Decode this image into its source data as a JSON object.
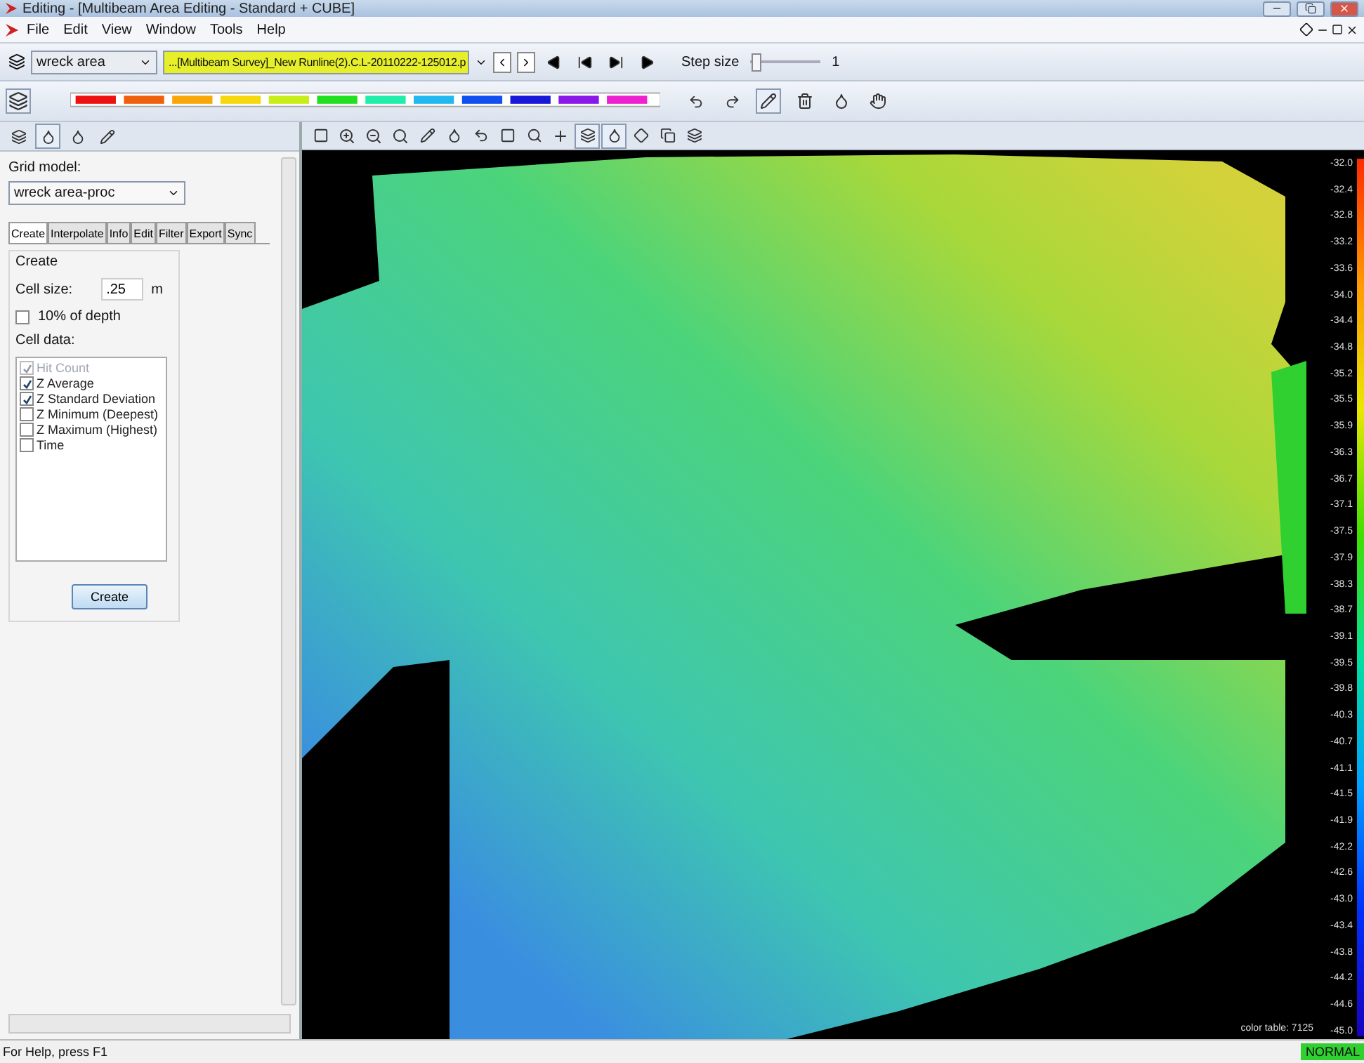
{
  "window": {
    "title": "Editing - [Multibeam Area Editing - Standard + CUBE]"
  },
  "menu": [
    "File",
    "Edit",
    "View",
    "Window",
    "Tools",
    "Help"
  ],
  "toolbar": {
    "area": "wreck area",
    "line": "...[Multibeam Survey]_New Runline(2).C.L-20110222-125012.p",
    "step_label": "Step size",
    "step_slider": {
      "level": 0.02
    },
    "step_value": "1"
  },
  "panel": {
    "grid_model_label": "Grid model:",
    "grid_model": "wreck area-proc",
    "tabs": [
      {
        "label": "Create",
        "selected": true
      },
      {
        "label": "Interpolate",
        "selected": false
      },
      {
        "label": "Info",
        "selected": false
      },
      {
        "label": "Edit",
        "selected": false
      },
      {
        "label": "Filter",
        "selected": false
      },
      {
        "label": "Export",
        "selected": false
      },
      {
        "label": "Sync",
        "selected": false
      }
    ],
    "group_title": "Create",
    "cell_size_label": "Cell size:",
    "cell_size": ".25",
    "cell_size_unit": "m",
    "depth_option": {
      "label": "10% of depth",
      "checked": false
    },
    "cell_data_label": "Cell data:",
    "cell_data": [
      {
        "label": "Hit Count",
        "checked": true,
        "disabled": true
      },
      {
        "label": "Z Average",
        "checked": true,
        "disabled": false
      },
      {
        "label": "Z Standard Deviation",
        "checked": true,
        "disabled": false
      },
      {
        "label": "Z Minimum (Deepest)",
        "checked": false,
        "disabled": false
      },
      {
        "label": "Z Maximum (Highest)",
        "checked": false,
        "disabled": false
      },
      {
        "label": "Time",
        "checked": false,
        "disabled": false
      }
    ],
    "button": "Create"
  },
  "scale": [
    "-32.0",
    "-32.4",
    "-32.8",
    "-33.2",
    "-33.6",
    "-34.0",
    "-34.4",
    "-34.8",
    "-35.2",
    "-35.5",
    "-35.9",
    "-36.3",
    "-36.7",
    "-37.1",
    "-37.5",
    "-37.9",
    "-38.3",
    "-38.7",
    "-39.1",
    "-39.5",
    "-39.8",
    "-40.3",
    "-40.7",
    "-41.1",
    "-41.5",
    "-41.9",
    "-42.2",
    "-42.6",
    "-43.0",
    "-43.4",
    "-43.8",
    "-44.2",
    "-44.6",
    "-45.0"
  ],
  "color_table": "color table: 7125",
  "status_bar": {
    "help": "For Help, press F1",
    "mode": "NORMAL"
  }
}
